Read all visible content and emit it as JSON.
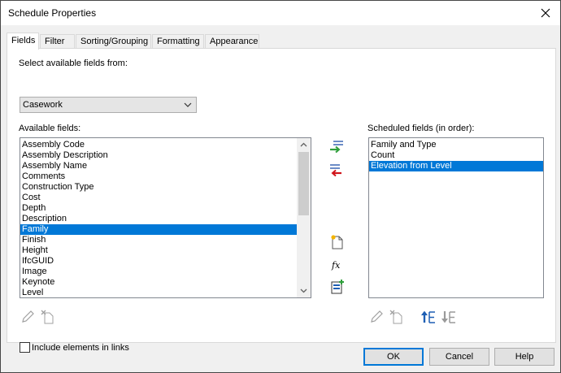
{
  "window": {
    "title": "Schedule Properties"
  },
  "tabs": [
    {
      "label": "Fields"
    },
    {
      "label": "Filter"
    },
    {
      "label": "Sorting/Grouping"
    },
    {
      "label": "Formatting"
    },
    {
      "label": "Appearance"
    }
  ],
  "fields_tab": {
    "select_from_label": "Select available fields from:",
    "select_from_value": "Casework",
    "available_label": "Available fields:",
    "available_items": [
      "Assembly Code",
      "Assembly Description",
      "Assembly Name",
      "Comments",
      "Construction Type",
      "Cost",
      "Depth",
      "Description",
      "Family",
      "Finish",
      "Height",
      "IfcGUID",
      "Image",
      "Keynote",
      "Level"
    ],
    "available_selected": "Family",
    "scheduled_label": "Scheduled fields (in order):",
    "scheduled_items": [
      "Family and Type",
      "Count",
      "Elevation from Level"
    ],
    "scheduled_selected": "Elevation from Level",
    "include_links_label": "Include elements in links",
    "include_links_checked": false
  },
  "buttons": {
    "ok": "OK",
    "cancel": "Cancel",
    "help": "Help"
  },
  "colors": {
    "selection": "#0078d7",
    "arrow_add": "#2e9e3a",
    "arrow_remove": "#d0141b"
  }
}
